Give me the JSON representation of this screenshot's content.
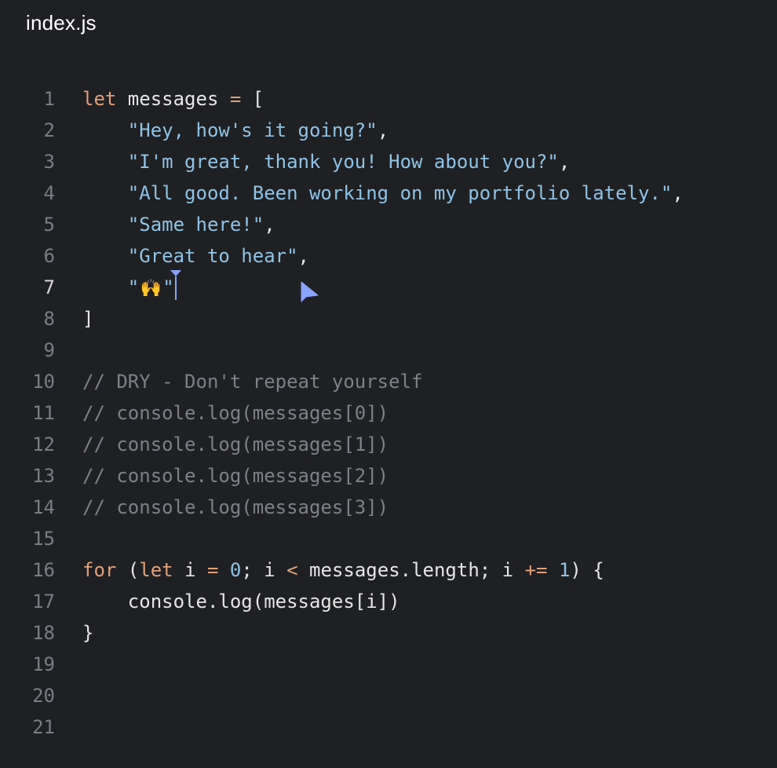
{
  "tab": {
    "title": "index.js"
  },
  "colors": {
    "background": "#1f2023",
    "keyword": "#e0a07a",
    "string": "#8ec3e6",
    "comment": "#7d8187",
    "line_number": "#7a7d84",
    "caret": "#8aa2ff"
  },
  "editor": {
    "active_line": 7,
    "lines": [
      {
        "n": "1",
        "tokens": [
          [
            "kw",
            "let"
          ],
          [
            "plain",
            " messages "
          ],
          [
            "op",
            "="
          ],
          [
            "plain",
            " ["
          ]
        ]
      },
      {
        "n": "2",
        "tokens": [
          [
            "plain",
            "    "
          ],
          [
            "str",
            "\"Hey, how's it going?\""
          ],
          [
            "plain",
            ","
          ]
        ]
      },
      {
        "n": "3",
        "tokens": [
          [
            "plain",
            "    "
          ],
          [
            "str",
            "\"I'm great, thank you! How about you?\""
          ],
          [
            "plain",
            ","
          ]
        ]
      },
      {
        "n": "4",
        "tokens": [
          [
            "plain",
            "    "
          ],
          [
            "str",
            "\"All good. Been working on my portfolio lately.\""
          ],
          [
            "plain",
            ","
          ]
        ]
      },
      {
        "n": "5",
        "tokens": [
          [
            "plain",
            "    "
          ],
          [
            "str",
            "\"Same here!\""
          ],
          [
            "plain",
            ","
          ]
        ]
      },
      {
        "n": "6",
        "tokens": [
          [
            "plain",
            "    "
          ],
          [
            "str",
            "\"Great to hear\""
          ],
          [
            "plain",
            ","
          ]
        ]
      },
      {
        "n": "7",
        "tokens": [
          [
            "plain",
            "    "
          ],
          [
            "str",
            "\""
          ],
          [
            "emoji",
            "🙌"
          ],
          [
            "str",
            "\""
          ],
          [
            "caret",
            ""
          ]
        ]
      },
      {
        "n": "8",
        "tokens": [
          [
            "plain",
            "]"
          ]
        ]
      },
      {
        "n": "9",
        "tokens": []
      },
      {
        "n": "10",
        "tokens": [
          [
            "cmt",
            "// DRY - Don't repeat yourself"
          ]
        ]
      },
      {
        "n": "11",
        "tokens": [
          [
            "cmt",
            "// console.log(messages[0])"
          ]
        ]
      },
      {
        "n": "12",
        "tokens": [
          [
            "cmt",
            "// console.log(messages[1])"
          ]
        ]
      },
      {
        "n": "13",
        "tokens": [
          [
            "cmt",
            "// console.log(messages[2])"
          ]
        ]
      },
      {
        "n": "14",
        "tokens": [
          [
            "cmt",
            "// console.log(messages[3])"
          ]
        ]
      },
      {
        "n": "15",
        "tokens": []
      },
      {
        "n": "16",
        "tokens": [
          [
            "kw",
            "for"
          ],
          [
            "plain",
            " ("
          ],
          [
            "kw",
            "let"
          ],
          [
            "plain",
            " i "
          ],
          [
            "op",
            "="
          ],
          [
            "plain",
            " "
          ],
          [
            "num",
            "0"
          ],
          [
            "plain",
            "; i "
          ],
          [
            "op",
            "<"
          ],
          [
            "plain",
            " messages.length; i "
          ],
          [
            "op",
            "+="
          ],
          [
            "plain",
            " "
          ],
          [
            "num",
            "1"
          ],
          [
            "plain",
            ") {"
          ]
        ]
      },
      {
        "n": "17",
        "tokens": [
          [
            "plain",
            "    console.log(messages[i])"
          ]
        ]
      },
      {
        "n": "18",
        "tokens": [
          [
            "plain",
            "}"
          ]
        ]
      },
      {
        "n": "19",
        "tokens": []
      },
      {
        "n": "20",
        "tokens": []
      },
      {
        "n": "21",
        "tokens": []
      }
    ]
  },
  "icons": {
    "pointer": "mouse-pointer-icon",
    "caret": "text-caret-icon"
  }
}
